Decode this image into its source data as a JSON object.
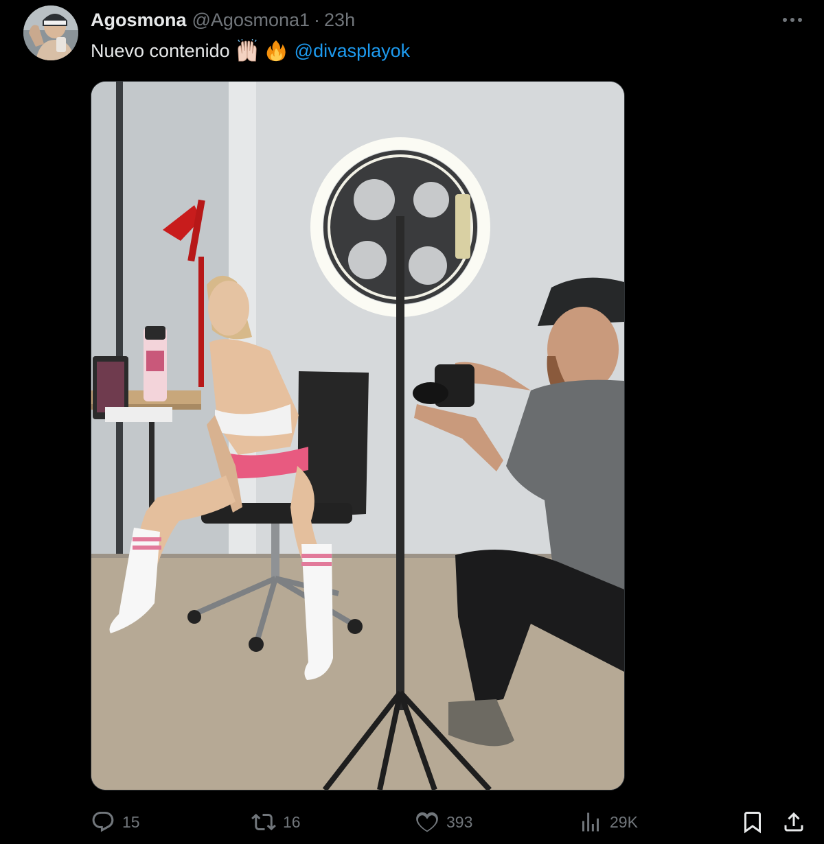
{
  "tweet": {
    "author": {
      "display_name": "Agosmona",
      "handle": "@Agosmona1",
      "separator": "·",
      "time": "23h"
    },
    "text": "Nuevo contenido",
    "emojis": [
      "raised-hands-emoji",
      "fire-emoji"
    ],
    "mention": "@divasplayok",
    "media": {
      "kind": "photo"
    },
    "actions": {
      "replies": "15",
      "reposts": "16",
      "likes": "393",
      "views": "29K"
    }
  },
  "icons": [
    "more-icon",
    "reply-icon",
    "repost-icon",
    "like-icon",
    "views-icon",
    "bookmark-icon",
    "share-icon"
  ],
  "colors": {
    "background": "#000000",
    "text": "#e7e9ea",
    "secondary": "#71767b",
    "link": "#1d9bf0"
  }
}
